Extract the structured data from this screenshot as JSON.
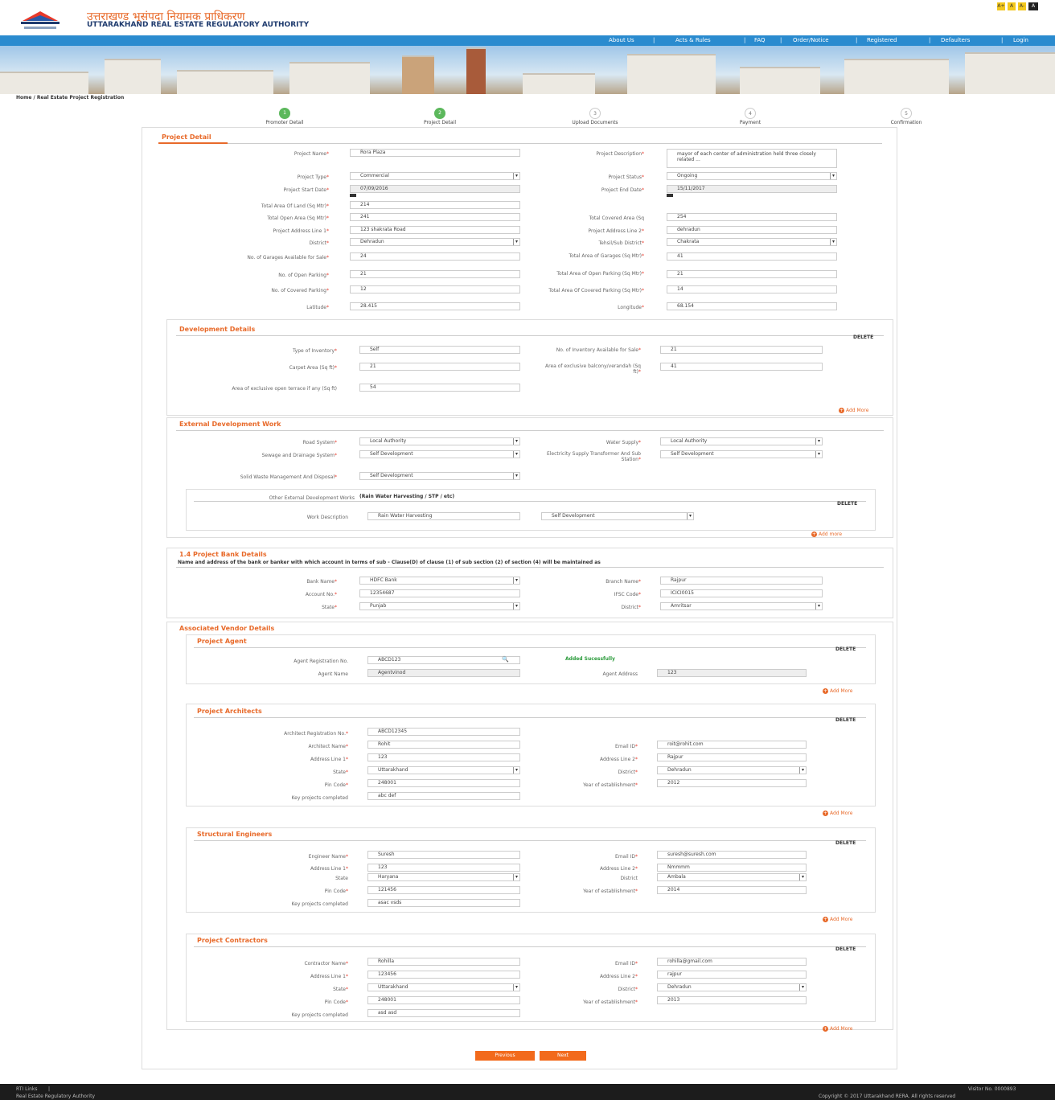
{
  "header": {
    "title_hindi": "उत्तराखण्ड भूसंपदा नियामक प्राधिकरण",
    "title_english": "UTTARAKHAND REAL ESTATE REGULATORY AUTHORITY",
    "font_sizes": [
      "A+",
      "A",
      "A-",
      "A"
    ]
  },
  "nav": [
    "About Us",
    "Acts & Rules",
    "FAQ",
    "Order/Notice",
    "Registered",
    "Defaulters",
    "Login"
  ],
  "breadcrumb": "Home / Real Estate Project Registration",
  "steps": [
    {
      "num": "1",
      "label": "Promoter Detail",
      "done": true
    },
    {
      "num": "2",
      "label": "Project Detail",
      "done": true
    },
    {
      "num": "3",
      "label": "Upload Documents",
      "done": false
    },
    {
      "num": "4",
      "label": "Payment",
      "done": false
    },
    {
      "num": "5",
      "label": "Confirmation",
      "done": false
    }
  ],
  "project_detail": {
    "heading": "Project Detail",
    "project_name": "Rora Plaza",
    "project_description": "mayor of each center of administration held three closely related ...",
    "project_type": "Commercial",
    "project_status": "Ongoing",
    "start_date": "07/09/2016",
    "end_date": "15/11/2017",
    "total_area_land": "214",
    "total_open_area": "241",
    "total_covered_area": "254",
    "address1": "123 shakrata Road",
    "address2": "dehradun",
    "district": "Dehradun",
    "tehsil": "Chakrata",
    "garages_available": "24",
    "garages_area": "41",
    "open_parking": "21",
    "open_parking_area": "21",
    "covered_parking": "12",
    "covered_parking_area": "14",
    "latitude": "28.415",
    "longitude": "68.154"
  },
  "labels": {
    "project_name": "Project Name",
    "project_description": "Project Description",
    "project_type": "Project Type",
    "project_status": "Project Status",
    "start_date": "Project Start Date",
    "end_date": "Project End Date",
    "total_area_land": "Total Area Of Land (Sq Mtr)",
    "total_open_area": "Total Open Area (Sq Mtr)",
    "total_covered_area": "Total Covered Area (Sq",
    "address1": "Project Address Line 1",
    "address2": "Project Address Line 2",
    "district": "District",
    "tehsil": "Tehsil/Sub District",
    "garages_available": "No. of Garages Available for Sale",
    "garages_area": "Total Area of Garages (Sq Mtr)",
    "open_parking": "No. of Open Parking",
    "open_parking_area": "Total Area of Open Parking (Sq Mtr)",
    "covered_parking": "No. of Covered Parking",
    "covered_parking_area": "Total Area Of Covered Parking (Sq Mtr)",
    "latitude": "Latitude",
    "longitude": "Longitude"
  },
  "development": {
    "heading": "Development Details",
    "delete": "DELETE",
    "add_more": "Add More",
    "inventory_type_label": "Type of Inventory",
    "inventory_type": "Self",
    "inventory_count_label": "No. of Inventory Available for Sale",
    "inventory_count": "21",
    "carpet_label": "Carpet Area (Sq ft)",
    "carpet": "21",
    "balcony_label": "Area of exclusive balcony/verandah (Sq ft)",
    "balcony": "41",
    "terrace_label": "Area of exclusive open terrace if any (Sq ft)",
    "terrace": "54"
  },
  "external": {
    "heading": "External Development Work",
    "add_more": "Add more",
    "delete": "DELETE",
    "road_label": "Road System",
    "road": "Local Authority",
    "water_label": "Water Supply",
    "water": "Local Authority",
    "sewage_label": "Sewage and Drainage System",
    "sewage": "Self Development",
    "electric_label": "Electricity Supply Transformer And Sub Station",
    "electric": "Self Development",
    "solid_label": "Solid Waste Management And Disposal",
    "solid": "Self Development",
    "other_label": "Other External Development Works",
    "other_note": "(Rain Water Harvesting / STP / etc)",
    "work_label": "Work Description",
    "work": "Rain Water Harvesting",
    "work_type": "Self Development"
  },
  "bank": {
    "heading": "1.4 Project Bank Details",
    "note": "Name and address of the bank or banker with which account in terms of sub - Clause(D) of clause (1) of sub section (2) of section (4) will be maintained as",
    "bank_label": "Bank Name",
    "bank": "HDFC Bank",
    "branch_label": "Branch Name",
    "branch": "Rajpur",
    "account_label": "Account No.",
    "account": "12354687",
    "ifsc_label": "IFSC Code",
    "ifsc": "ICICI0015",
    "state_label": "State",
    "state": "Punjab",
    "district_label": "District",
    "district": "Amritsar"
  },
  "vendor": {
    "heading": "Associated Vendor Details",
    "agent": {
      "heading": "Project Agent",
      "delete": "DELETE",
      "reg_label": "Agent Registration No.",
      "reg": "ABCD123",
      "msg": "Added Sucessfully",
      "name_label": "Agent Name",
      "name": "Agentvinod",
      "addr_label": "Agent Address",
      "addr": "123",
      "add_more": "Add More"
    },
    "architects": {
      "heading": "Project Architects",
      "delete": "DELETE",
      "reg_label": "Architect Registration No.",
      "reg": "ABCD12345",
      "name_label": "Architect Name",
      "name": "Rohit",
      "email_label": "Email ID",
      "email": "roit@rohit.com",
      "a1_label": "Address Line 1",
      "a1": "123",
      "a2_label": "Address Line 2",
      "a2": "Rajpur",
      "state_label": "State",
      "state": "Uttarakhand",
      "district_label": "District",
      "district": "Dehradun",
      "pin_label": "Pin Code",
      "pin": "248001",
      "year_label": "Year of establishment",
      "year": "2012",
      "key_label": "Key projects completed",
      "key": "abc def",
      "add_more": "Add More"
    },
    "engineers": {
      "heading": "Structural Engineers",
      "delete": "DELETE",
      "name_label": "Engineer Name",
      "name": "Suresh",
      "email_label": "Email ID",
      "email": "suresh@suresh.com",
      "a1_label": "Address Line 1",
      "a1": "123",
      "a2_label": "Address Line 2",
      "a2": "Nmmmm",
      "state_label": "State",
      "state": "Haryana",
      "district_label": "District",
      "district": "Ambala",
      "pin_label": "Pin Code",
      "pin": "121456",
      "year_label": "Year of establishment",
      "year": "2014",
      "key_label": "Key projects completed",
      "key": "asac vsds",
      "add_more": "Add More"
    },
    "contractors": {
      "heading": "Project Contractors",
      "delete": "DELETE",
      "name_label": "Contractor Name",
      "name": "Rohilla",
      "email_label": "Email ID",
      "email": "rohilla@gmail.com",
      "a1_label": "Address Line 1",
      "a1": "123456",
      "a2_label": "Address Line 2",
      "a2": "rajpur",
      "state_label": "State",
      "state": "Uttarakhand",
      "district_label": "District",
      "district": "Dehradun",
      "pin_label": "Pin Code",
      "pin": "248001",
      "year_label": "Year of establishment",
      "year": "2013",
      "key_label": "Key projects completed",
      "key": "asd asd",
      "add_more": "Add More"
    }
  },
  "buttons": {
    "previous": "Previous",
    "next": "Next"
  },
  "footer": {
    "links": "RTI Links",
    "org": "Real Estate Regulatory Authority",
    "visitor": "Visitor No. 0000893",
    "copyright": "Copyright © 2017 Uttarakhand RERA. All rights reserved"
  }
}
